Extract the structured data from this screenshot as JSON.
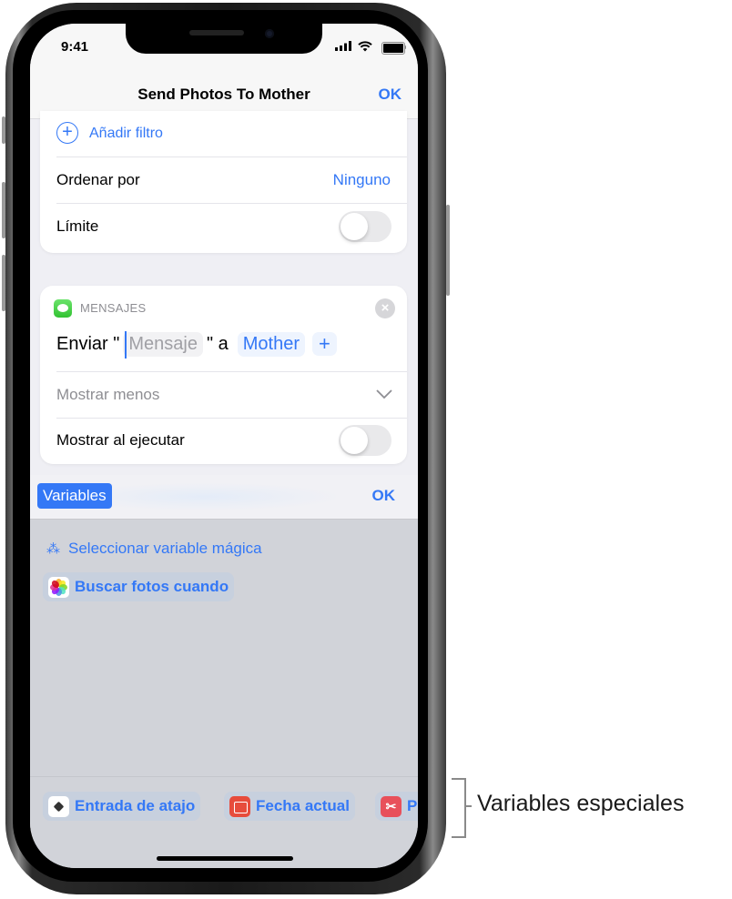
{
  "status_bar": {
    "time": "9:41",
    "icons": [
      "cellular-signal-icon",
      "wifi-icon",
      "battery-icon"
    ]
  },
  "nav": {
    "title": "Send Photos To Mother",
    "done_label": "OK"
  },
  "filter_card": {
    "add_filter_label": "Añadir filtro",
    "sort_label": "Ordenar por",
    "sort_value": "Ninguno",
    "limit_label": "Límite",
    "limit_enabled": false
  },
  "message_action": {
    "app_label": "MENSAJES",
    "sentence_prefix": "Enviar \"",
    "message_placeholder": "Mensaje",
    "sentence_middle": "\" a",
    "recipient": "Mother",
    "add_recipient": "+",
    "show_less_label": "Mostrar menos",
    "show_when_run_label": "Mostrar al ejecutar",
    "show_when_run_enabled": false
  },
  "keyboard_toolbar": {
    "variables_label": "Variables",
    "ok_label": "OK"
  },
  "variables_panel": {
    "magic_variable_label": "Seleccionar variable mágica",
    "suggested_variable": "Buscar fotos cuando",
    "special_variables": [
      {
        "label": "Entrada de atajo",
        "icon": "shortcut-input-icon"
      },
      {
        "label": "Fecha actual",
        "icon": "calendar-icon"
      },
      {
        "label": "P",
        "icon": "scissors-icon"
      }
    ]
  },
  "callout": {
    "label": "Variables especiales"
  }
}
